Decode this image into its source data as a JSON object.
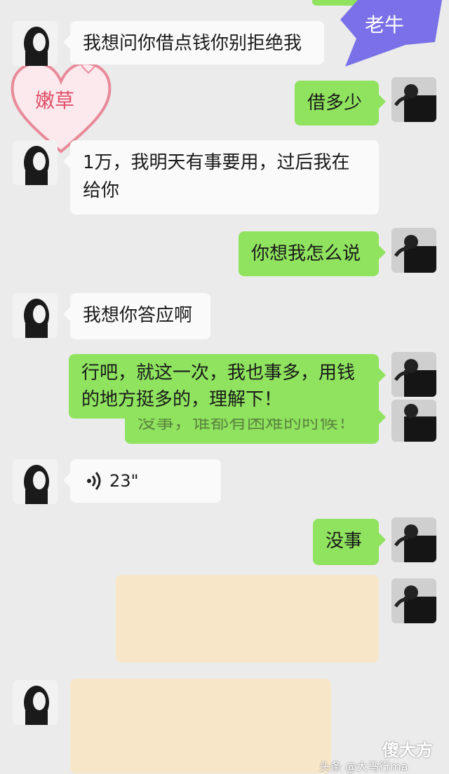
{
  "labels": {
    "left_name": "嫩草",
    "right_name": "老牛"
  },
  "messages": {
    "m1": "我想问你借点钱你别拒绝我",
    "m2": "借多少",
    "m3": "1万，我明天有事要用，过后我在给你",
    "m4": "你想我怎么说",
    "m5": "我想你答应啊",
    "m6": "行吧，就这一次，我也事多，用钱的地方挺多的，理解下！",
    "m6_ghost": "没事，谁都有困难的时候！",
    "m7_voice": "23\"",
    "m8": "没事"
  },
  "watermark": {
    "logo": "傻大方",
    "text": "头条 @大马行ma"
  },
  "colors": {
    "incoming": "#fafafa",
    "outgoing": "#8fe35f",
    "blur": "#f8e6c9",
    "background": "#ebebeb",
    "heart": "#e88a99",
    "tag": "#7a70e8"
  },
  "icons": {
    "voice": "wifi-voice-icon",
    "avatar_left": "girl-silhouette-icon",
    "avatar_right": "man-photo-icon"
  }
}
